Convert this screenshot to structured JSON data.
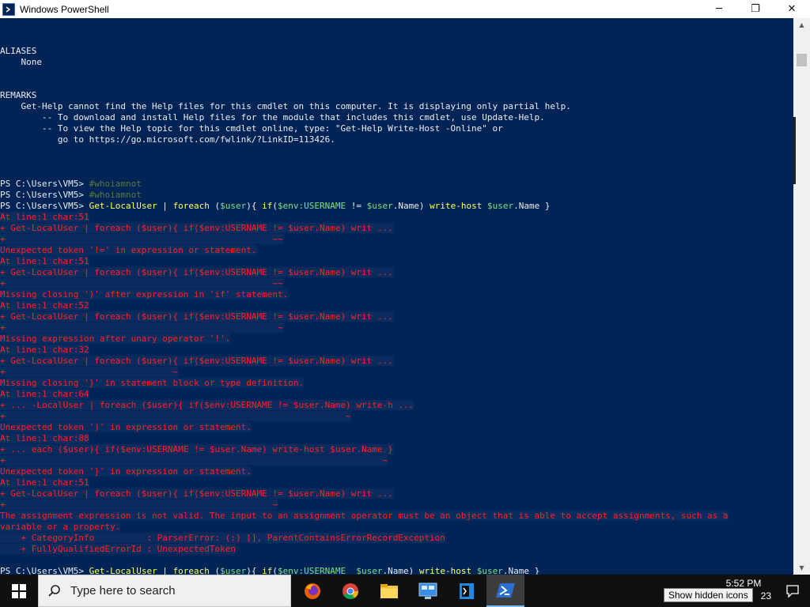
{
  "window": {
    "title": "Windows PowerShell",
    "minimize": "─",
    "maximize": "❐",
    "close": "✕"
  },
  "console": {
    "lines": [
      {
        "row": 2,
        "parts": [
          {
            "t": "ALIASES"
          }
        ]
      },
      {
        "row": 3,
        "parts": [
          {
            "t": "    None"
          }
        ]
      },
      {
        "row": 6,
        "parts": [
          {
            "t": "REMARKS"
          }
        ]
      },
      {
        "row": 7,
        "parts": [
          {
            "t": "    Get-Help cannot find the Help files for this cmdlet on this computer. It is displaying only partial help."
          }
        ]
      },
      {
        "row": 8,
        "parts": [
          {
            "t": "        -- To download and install Help files for the module that includes this cmdlet, use Update-Help."
          }
        ]
      },
      {
        "row": 9,
        "parts": [
          {
            "t": "        -- To view the Help topic for this cmdlet online, type: \"Get-Help Write-Host -Online\" or"
          }
        ]
      },
      {
        "row": 10,
        "parts": [
          {
            "t": "           go to https://go.microsoft.com/fwlink/?LinkID=113426."
          }
        ]
      },
      {
        "row": 14,
        "parts": [
          {
            "t": "PS C:\\Users\\VM5> "
          },
          {
            "t": "#whoiamnot",
            "c": "cm"
          }
        ]
      },
      {
        "row": 15,
        "parts": [
          {
            "t": "PS C:\\Users\\VM5> "
          },
          {
            "t": "#whoiamnot",
            "c": "cm"
          }
        ]
      },
      {
        "row": 16,
        "parts": [
          {
            "t": "PS C:\\Users\\VM5> "
          },
          {
            "t": "Get-LocalUser",
            "c": "kw"
          },
          {
            "t": " | "
          },
          {
            "t": "foreach",
            "c": "kw"
          },
          {
            "t": " ("
          },
          {
            "t": "$user",
            "c": "var"
          },
          {
            "t": "){ "
          },
          {
            "t": "if",
            "c": "kw"
          },
          {
            "t": "("
          },
          {
            "t": "$env:USERNAME",
            "c": "var"
          },
          {
            "t": " != "
          },
          {
            "t": "$user",
            "c": "var"
          },
          {
            "t": ".Name) "
          },
          {
            "t": "write-host",
            "c": "kw"
          },
          {
            "t": " "
          },
          {
            "t": "$user",
            "c": "var"
          },
          {
            "t": ".Name }"
          }
        ]
      },
      {
        "row": 17,
        "parts": [
          {
            "t": "At line:1 char:51",
            "c": "err"
          }
        ]
      },
      {
        "row": 18,
        "parts": [
          {
            "t": "+ Get-LocalUser | foreach ($user){ if($env:USERNAME != $user.Name) writ ...",
            "c": "err"
          }
        ]
      },
      {
        "row": 19,
        "parts": [
          {
            "t": "+                                                   ~~",
            "c": "err"
          }
        ]
      },
      {
        "row": 20,
        "parts": [
          {
            "t": "Unexpected token '!=' in expression or statement.",
            "c": "err"
          }
        ]
      },
      {
        "row": 21,
        "parts": [
          {
            "t": "At line:1 char:51",
            "c": "err"
          }
        ]
      },
      {
        "row": 22,
        "parts": [
          {
            "t": "+ Get-LocalUser | foreach ($user){ if($env:USERNAME != $user.Name) writ ...",
            "c": "err"
          }
        ]
      },
      {
        "row": 23,
        "parts": [
          {
            "t": "+                                                   ~~",
            "c": "err"
          }
        ]
      },
      {
        "row": 24,
        "parts": [
          {
            "t": "Missing closing ')' after expression in 'if' statement.",
            "c": "err"
          }
        ]
      },
      {
        "row": 25,
        "parts": [
          {
            "t": "At line:1 char:52",
            "c": "err"
          }
        ]
      },
      {
        "row": 26,
        "parts": [
          {
            "t": "+ Get-LocalUser | foreach ($user){ if($env:USERNAME != $user.Name) writ ...",
            "c": "err"
          }
        ]
      },
      {
        "row": 27,
        "parts": [
          {
            "t": "+                                                    ~",
            "c": "err"
          }
        ]
      },
      {
        "row": 28,
        "parts": [
          {
            "t": "Missing expression after unary operator '!'.",
            "c": "err"
          }
        ]
      },
      {
        "row": 29,
        "parts": [
          {
            "t": "At line:1 char:32",
            "c": "err"
          }
        ]
      },
      {
        "row": 30,
        "parts": [
          {
            "t": "+ Get-LocalUser | foreach ($user){ if($env:USERNAME != $user.Name) writ ...",
            "c": "err"
          }
        ]
      },
      {
        "row": 31,
        "parts": [
          {
            "t": "+                                ~",
            "c": "err"
          }
        ]
      },
      {
        "row": 32,
        "parts": [
          {
            "t": "Missing closing '}' in statement block or type definition.",
            "c": "err"
          }
        ]
      },
      {
        "row": 33,
        "parts": [
          {
            "t": "At line:1 char:64",
            "c": "err"
          }
        ]
      },
      {
        "row": 34,
        "parts": [
          {
            "t": "+ ... -LocalUser | foreach ($user){ if($env:USERNAME != $user.Name) write-h ...",
            "c": "err"
          }
        ]
      },
      {
        "row": 35,
        "parts": [
          {
            "t": "+                                                                 ~",
            "c": "err"
          }
        ]
      },
      {
        "row": 36,
        "parts": [
          {
            "t": "Unexpected token ')' in expression or statement.",
            "c": "err"
          }
        ]
      },
      {
        "row": 37,
        "parts": [
          {
            "t": "At line:1 char:88",
            "c": "err"
          }
        ]
      },
      {
        "row": 38,
        "parts": [
          {
            "t": "+ ... each ($user){ if($env:USERNAME != $user.Name) write-host $user.Name }",
            "c": "err"
          }
        ]
      },
      {
        "row": 39,
        "parts": [
          {
            "t": "+                                                                        ~",
            "c": "err"
          }
        ]
      },
      {
        "row": 40,
        "parts": [
          {
            "t": "Unexpected token '}' in expression or statement.",
            "c": "err"
          }
        ]
      },
      {
        "row": 41,
        "parts": [
          {
            "t": "At line:1 char:51",
            "c": "err"
          }
        ]
      },
      {
        "row": 42,
        "parts": [
          {
            "t": "+ Get-LocalUser | foreach ($user){ if($env:USERNAME != $user.Name) writ ...",
            "c": "err"
          }
        ]
      },
      {
        "row": 43,
        "parts": [
          {
            "t": "+                                                   ~",
            "c": "err"
          }
        ]
      },
      {
        "row": 44,
        "parts": [
          {
            "t": "The assignment expression is not valid. The input to an assignment operator must be an object that is able to accept assignments, such as a",
            "c": "err"
          }
        ]
      },
      {
        "row": 45,
        "parts": [
          {
            "t": "variable or a property.",
            "c": "err"
          }
        ]
      },
      {
        "row": 46,
        "parts": [
          {
            "t": "    + CategoryInfo          : ParserError: (:) [], ParentContainsErrorRecordException",
            "c": "err"
          }
        ]
      },
      {
        "row": 47,
        "parts": [
          {
            "t": "    + FullyQualifiedErrorId : UnexpectedToken",
            "c": "err"
          }
        ]
      },
      {
        "row": 49,
        "parts": [
          {
            "t": "PS C:\\Users\\VM5> "
          },
          {
            "t": "Get-LocalUser",
            "c": "kw"
          },
          {
            "t": " | "
          },
          {
            "t": "foreach",
            "c": "kw"
          },
          {
            "t": " ("
          },
          {
            "t": "$user",
            "c": "var"
          },
          {
            "t": "){ "
          },
          {
            "t": "if",
            "c": "kw"
          },
          {
            "t": "("
          },
          {
            "t": "$env:USERNAME",
            "c": "var"
          },
          {
            "t": " _"
          },
          {
            "t": "$user",
            "c": "var"
          },
          {
            "t": ".Name) "
          },
          {
            "t": "write-host",
            "c": "kw"
          },
          {
            "t": " "
          },
          {
            "t": "$user",
            "c": "var"
          },
          {
            "t": ".Name }"
          }
        ]
      }
    ]
  },
  "taskbar": {
    "search_placeholder": "Type here to search",
    "time": "5:52 PM",
    "date_fragment": "23",
    "tooltip": "Show hidden icons",
    "icons": [
      "windows-start-icon",
      "firefox-icon",
      "chrome-icon",
      "file-explorer-icon",
      "control-panel-icon",
      "visual-studio-icon",
      "powershell-icon",
      "notification-icon"
    ]
  },
  "colors": {
    "console_bg": "#012456",
    "error_fg": "#ff2222",
    "keyword": "#ffff66",
    "variable": "#7fe07f"
  }
}
